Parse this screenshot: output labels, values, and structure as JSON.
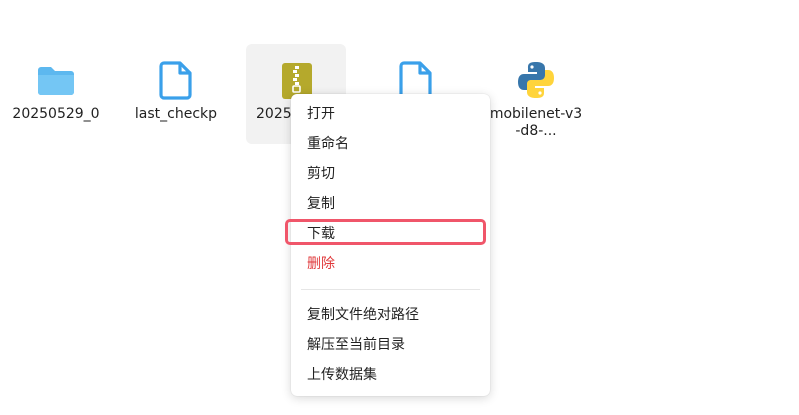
{
  "files": [
    {
      "name": "20250529_0",
      "icon": "folder-icon"
    },
    {
      "name": "last_checkp",
      "icon": "document-icon"
    },
    {
      "name": "2025",
      "icon": "zip-archive-icon",
      "selected": true
    },
    {
      "name": "",
      "icon": "document-icon"
    },
    {
      "name": "mobilenet-v3-d8-...",
      "icon": "python-file-icon"
    }
  ],
  "context_menu": {
    "items": [
      {
        "label": "打开"
      },
      {
        "label": "重命名"
      },
      {
        "label": "剪切"
      },
      {
        "label": "复制"
      },
      {
        "label": "下载",
        "highlighted": true
      },
      {
        "label": "删除",
        "danger": true
      },
      {
        "label": "复制文件绝对路径"
      },
      {
        "label": "解压至当前目录"
      },
      {
        "label": "上传数据集"
      }
    ]
  },
  "colors": {
    "folder": "#5db8ef",
    "document": "#3aa0ea",
    "zip": "#b5a92c",
    "danger": "#e0383a",
    "highlight": "#f0566a",
    "python_blue": "#3776ab",
    "python_yellow": "#ffd43b"
  }
}
